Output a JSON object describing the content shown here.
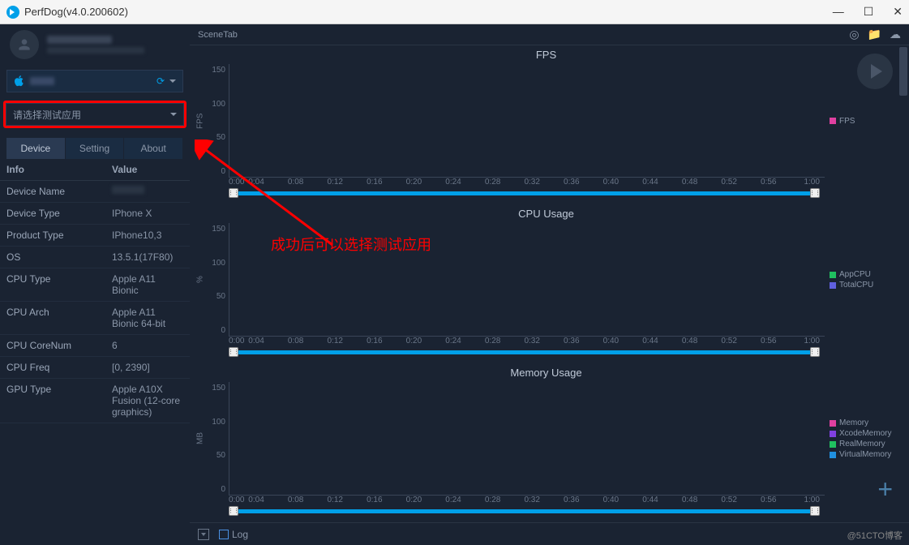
{
  "window": {
    "title": "PerfDog(v4.0.200602)"
  },
  "topbar": {
    "scenetab": "SceneTab"
  },
  "sidebar": {
    "app_select_placeholder": "请选择测试应用",
    "tabs": {
      "device": "Device",
      "setting": "Setting",
      "about": "About"
    },
    "info_header": {
      "c1": "Info",
      "c2": "Value"
    },
    "info_rows": [
      {
        "label": "Device Name",
        "value": ""
      },
      {
        "label": "Device Type",
        "value": "IPhone X"
      },
      {
        "label": "Product Type",
        "value": "IPhone10,3"
      },
      {
        "label": "OS",
        "value": "13.5.1(17F80)"
      },
      {
        "label": "CPU Type",
        "value": "Apple A11 Bionic"
      },
      {
        "label": "CPU Arch",
        "value": "Apple A11 Bionic 64-bit"
      },
      {
        "label": "CPU CoreNum",
        "value": "6"
      },
      {
        "label": "CPU Freq",
        "value": "[0, 2390]"
      },
      {
        "label": "GPU Type",
        "value": "Apple A10X Fusion (12-core graphics)"
      }
    ]
  },
  "charts": [
    {
      "title": "FPS",
      "ylabel": "FPS",
      "yticks": [
        "150",
        "100",
        "50",
        "0"
      ],
      "legend": [
        {
          "color": "#e040a0",
          "label": "FPS"
        }
      ]
    },
    {
      "title": "CPU Usage",
      "ylabel": "%",
      "yticks": [
        "150",
        "100",
        "50",
        "0"
      ],
      "legend": [
        {
          "color": "#20c060",
          "label": "AppCPU"
        },
        {
          "color": "#6060e0",
          "label": "TotalCPU"
        }
      ]
    },
    {
      "title": "Memory Usage",
      "ylabel": "MB",
      "yticks": [
        "150",
        "100",
        "50",
        "0"
      ],
      "legend": [
        {
          "color": "#e040a0",
          "label": "Memory"
        },
        {
          "color": "#8040e0",
          "label": "XcodeMemory"
        },
        {
          "color": "#20c060",
          "label": "RealMemory"
        },
        {
          "color": "#2090e0",
          "label": "VirtualMemory"
        }
      ]
    }
  ],
  "xticks": [
    "0:00",
    "0:04",
    "0:08",
    "0:12",
    "0:16",
    "0:20",
    "0:24",
    "0:28",
    "0:32",
    "0:36",
    "0:40",
    "0:44",
    "0:48",
    "0:52",
    "0:56",
    "1:00"
  ],
  "bottombar": {
    "log": "Log"
  },
  "annotation": "成功后可以选择测试应用",
  "watermark": "@51CTO博客",
  "chart_data": {
    "type": "line",
    "x_range": [
      "0:00",
      "1:00"
    ],
    "series": [
      {
        "chart": "FPS",
        "name": "FPS",
        "values": []
      },
      {
        "chart": "CPU Usage",
        "name": "AppCPU",
        "values": []
      },
      {
        "chart": "CPU Usage",
        "name": "TotalCPU",
        "values": []
      },
      {
        "chart": "Memory Usage",
        "name": "Memory",
        "values": []
      },
      {
        "chart": "Memory Usage",
        "name": "XcodeMemory",
        "values": []
      },
      {
        "chart": "Memory Usage",
        "name": "RealMemory",
        "values": []
      },
      {
        "chart": "Memory Usage",
        "name": "VirtualMemory",
        "values": []
      }
    ],
    "ylim": [
      0,
      150
    ],
    "note": "charts are empty (no data recorded yet)"
  }
}
